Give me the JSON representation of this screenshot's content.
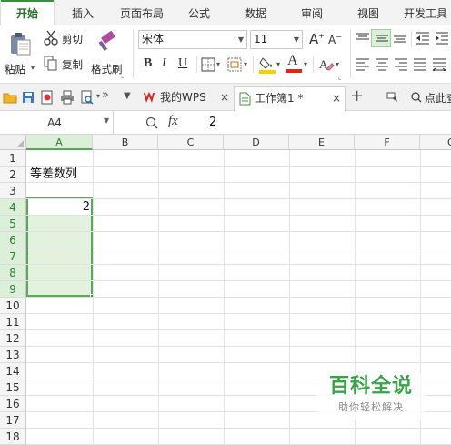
{
  "menu": {
    "tabs": [
      "开始",
      "插入",
      "页面布局",
      "公式",
      "数据",
      "审阅",
      "视图",
      "开发工具"
    ],
    "active_index": 0
  },
  "ribbon": {
    "paste_label": "粘贴",
    "cut_label": "剪切",
    "copy_label": "复制",
    "format_painter_label": "格式刷",
    "font_name": "宋体",
    "font_size": "11",
    "bold": "B",
    "italic": "I",
    "underline": "U",
    "grow_font": "A",
    "shrink_font": "A",
    "font_color_letter": "A",
    "accent_color": "#3c8d3c",
    "font_color_bar": "#e0241b",
    "fill_color_bar": "#f6d000"
  },
  "docbar": {
    "tabs": [
      {
        "label": "我的WPS",
        "close": "×",
        "icon": "wps-logo-icon"
      },
      {
        "label": "工作簿1 *",
        "close": "×",
        "icon": "sheet-doc-icon"
      }
    ],
    "new_tab": "+",
    "search_label": "点此查"
  },
  "formula_bar": {
    "cell_ref": "A4",
    "fx_label": "fx",
    "value": "2"
  },
  "grid": {
    "columns": [
      "A",
      "B",
      "C",
      "D",
      "E",
      "F",
      "G"
    ],
    "rows": [
      "1",
      "2",
      "3",
      "4",
      "5",
      "6",
      "7",
      "8",
      "9",
      "10",
      "11",
      "12",
      "13",
      "14",
      "15",
      "16",
      "17",
      "18"
    ],
    "cells": {
      "A2": "等差数列",
      "A4": "2"
    },
    "selection": "A4:A9"
  },
  "watermark": {
    "title": "百科全说",
    "subtitle": "助你轻松解决"
  }
}
